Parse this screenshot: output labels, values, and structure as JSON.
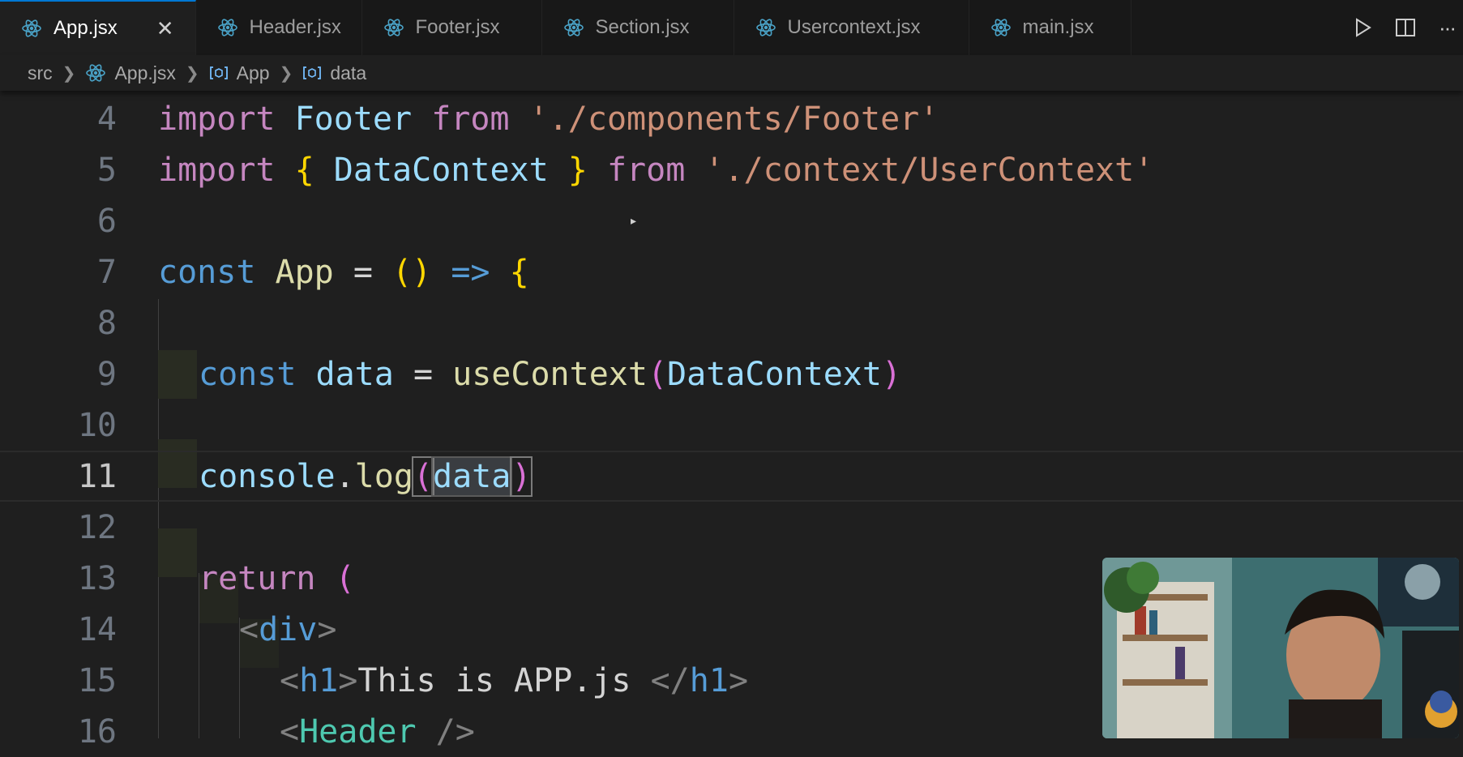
{
  "tabs": [
    {
      "label": "App.jsx",
      "active": true,
      "icon": "react-icon"
    },
    {
      "label": "Header.jsx",
      "active": false,
      "icon": "react-icon"
    },
    {
      "label": "Footer.jsx",
      "active": false,
      "icon": "react-icon"
    },
    {
      "label": "Section.jsx",
      "active": false,
      "icon": "react-icon"
    },
    {
      "label": "Usercontext.jsx",
      "active": false,
      "icon": "react-icon"
    },
    {
      "label": "main.jsx",
      "active": false,
      "icon": "react-icon"
    }
  ],
  "tab_close_glyph": "✕",
  "tab_actions": {
    "run": "run-icon",
    "split": "split-editor-icon",
    "more": "more-actions-icon",
    "more_glyph": "···"
  },
  "breadcrumb": {
    "folder": "src",
    "file": "App.jsx",
    "symbol1": "App",
    "symbol2": "data"
  },
  "editor": {
    "current_line": 11,
    "line_numbers": [
      "4",
      "5",
      "6",
      "7",
      "8",
      "9",
      "10",
      "11",
      "12",
      "13",
      "14",
      "15",
      "16"
    ],
    "l4": {
      "kw": "import",
      "id": "Footer",
      "from": "from",
      "str": "'./components/Footer'"
    },
    "l5": {
      "kw": "import",
      "ob": "{",
      "id": "DataContext",
      "cb": "}",
      "from": "from",
      "str": "'./context/UserContext'"
    },
    "l7": {
      "kw": "const",
      "id": "App",
      "eq": "=",
      "parens": "()",
      "arrow": "=>",
      "brace": "{"
    },
    "l9": {
      "kw": "const",
      "id": "data",
      "eq": "=",
      "fn": "useContext",
      "op": "(",
      "arg": "DataContext",
      "cp": ")"
    },
    "l11": {
      "obj": "console",
      "dot": ".",
      "fn": "log",
      "op": "(",
      "arg": "data",
      "cp": ")"
    },
    "l13": {
      "kw": "return",
      "op": "("
    },
    "l14": {
      "open": "<",
      "tag": "div",
      "close": ">"
    },
    "l15": {
      "open": "<",
      "tag": "h1",
      "close": ">",
      "text": "This is APP.js ",
      "endopen": "</",
      "endtag": "h1",
      "endclose": ">"
    },
    "l16": {
      "open": "<",
      "tag": "Header",
      "close": " />"
    }
  },
  "colors": {
    "background": "#1f1f1f",
    "tabbar": "#181818",
    "keyword": "#569cd6",
    "import": "#c586c0",
    "string": "#ce9178",
    "function": "#dcdcaa",
    "variable": "#9cdcfe"
  }
}
